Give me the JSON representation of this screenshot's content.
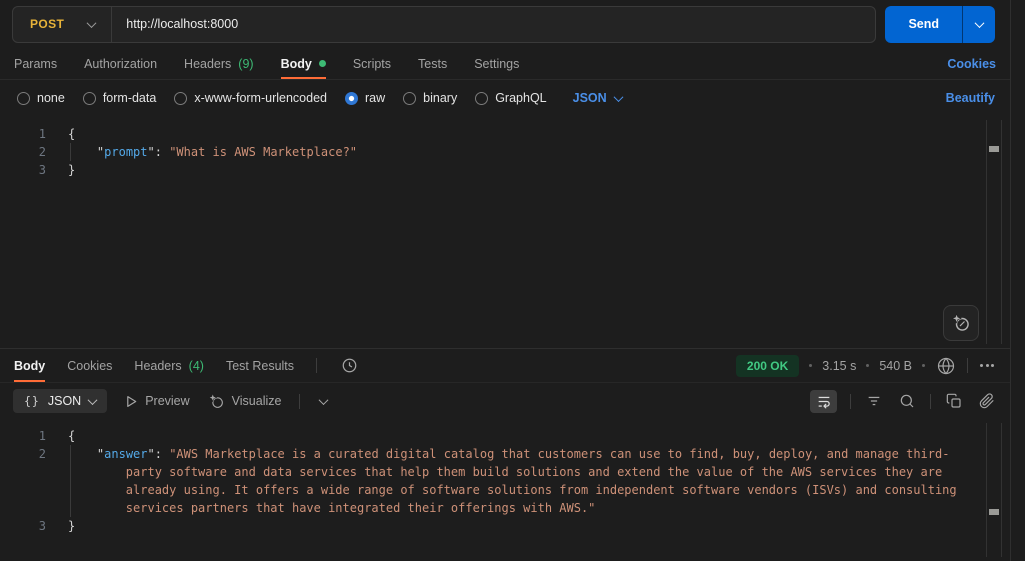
{
  "request": {
    "method": "POST",
    "url": "http://localhost:8000",
    "send_label": "Send",
    "tabs": [
      {
        "label": "Params"
      },
      {
        "label": "Authorization"
      },
      {
        "label": "Headers",
        "count": "(9)"
      },
      {
        "label": "Body",
        "active": true,
        "has_dot": true
      },
      {
        "label": "Scripts"
      },
      {
        "label": "Tests"
      },
      {
        "label": "Settings"
      }
    ],
    "cookies_link": "Cookies",
    "body_types": [
      {
        "label": "none"
      },
      {
        "label": "form-data"
      },
      {
        "label": "x-www-form-urlencoded"
      },
      {
        "label": "raw",
        "selected": true
      },
      {
        "label": "binary"
      },
      {
        "label": "GraphQL"
      }
    ],
    "raw_language": "JSON",
    "beautify_link": "Beautify",
    "editor": {
      "lines": [
        {
          "num": "1",
          "tokens": [
            {
              "t": "punc",
              "v": "{"
            }
          ]
        },
        {
          "num": "2",
          "hang": true,
          "guide": true,
          "tokens": [
            {
              "t": "punc",
              "v": "\""
            },
            {
              "t": "key",
              "v": "prompt"
            },
            {
              "t": "punc",
              "v": "\": "
            },
            {
              "t": "str",
              "v": "\"What is AWS Marketplace?\""
            }
          ]
        },
        {
          "num": "3",
          "tokens": [
            {
              "t": "punc",
              "v": "}"
            }
          ]
        }
      ]
    }
  },
  "response": {
    "tabs": [
      {
        "label": "Body",
        "active": true
      },
      {
        "label": "Cookies"
      },
      {
        "label": "Headers",
        "count": "(4)"
      },
      {
        "label": "Test Results"
      }
    ],
    "status": "200 OK",
    "time": "3.15 s",
    "size": "540 B",
    "toolbar": {
      "format": "JSON",
      "preview": "Preview",
      "visualize": "Visualize"
    },
    "editor": {
      "lines": [
        {
          "num": "1",
          "tokens": [
            {
              "t": "punc",
              "v": "{"
            }
          ]
        },
        {
          "num": "2",
          "hang": true,
          "guide": true,
          "tokens": [
            {
              "t": "punc",
              "v": "\""
            },
            {
              "t": "key",
              "v": "answer"
            },
            {
              "t": "punc",
              "v": "\": "
            },
            {
              "t": "str",
              "v": "\"AWS Marketplace is a curated digital catalog that customers can use to find, buy, deploy, and manage third-party software and data services that help them build solutions and extend the value of the AWS services they are already using. It offers a wide range of software solutions from independent software vendors (ISVs) and consulting services partners that have integrated their offerings with AWS.\""
            }
          ]
        },
        {
          "num": "3",
          "tokens": [
            {
              "t": "punc",
              "v": "}"
            }
          ]
        }
      ]
    }
  },
  "icons": {
    "method-caret-icon": "chevron-down",
    "send-caret-icon": "chevron-down",
    "raw-language-caret-icon": "chevron-down",
    "history-icon": "clock-history",
    "status-globe-icon": "globe",
    "response-more-icon": "ellipsis",
    "format-braces-icon": "{ }",
    "preview-icon": "play-outline",
    "visualize-icon": "sparkle-circle",
    "postbot-icon": "sparkle-circle",
    "wrap-text-icon": "wrap-text",
    "filter-icon": "filter-lines",
    "search-icon": "magnifier",
    "copy-icon": "copy",
    "link-icon": "paperclip"
  },
  "colors": {
    "background": "#1d1d1d",
    "method_post": "#e8b339",
    "send_blue": "#0265d2",
    "link_blue": "#4a8fe8",
    "active_tab_underline": "#ff6c37",
    "count_green": "#3dba74",
    "status_green": "#41c983",
    "status_pill_bg": "#143323",
    "code_key_blue": "#54a9e8",
    "code_string_orange": "#ce9178",
    "code_punct": "#d4d4d4"
  }
}
